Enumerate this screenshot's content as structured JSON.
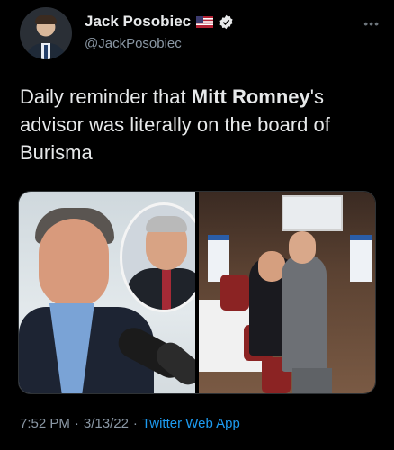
{
  "author": {
    "display_name": "Jack Posobiec",
    "handle": "@JackPosobiec",
    "flag_icon": "us-flag-icon",
    "verified_icon": "verified-badge-icon",
    "verified_color": "#1d9bf0"
  },
  "tweet": {
    "text_part1": "Daily reminder that ",
    "text_bold": "Mitt Romney",
    "text_part2": "'s advisor was literally on the board of Burisma"
  },
  "footer": {
    "time": "7:52 PM",
    "sep1": "·",
    "date": "3/13/22",
    "sep2": "·",
    "app": "Twitter Web App"
  },
  "colors": {
    "background": "#000000",
    "text": "#e7e9ea",
    "muted": "#8b98a5",
    "link": "#1d9bf0"
  }
}
